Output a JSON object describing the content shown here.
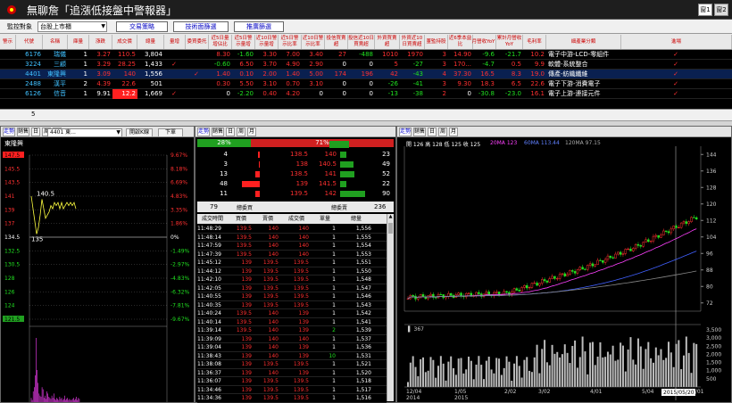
{
  "app": {
    "title": "無聊詹「追漲低接盤中警報器」",
    "win_buttons": [
      "窗1",
      "窗2"
    ]
  },
  "toolbar": {
    "monitor_label": "監控對象",
    "market_value": "台股上市櫃",
    "btn_strategy": "交易策略",
    "btn_tech": "技術面篩選",
    "btn_custom": "推廣篩選"
  },
  "grid": {
    "headers": [
      "警示",
      "代號",
      "名稱",
      "庫量",
      "漲跌",
      "成交價",
      "總量",
      "量增",
      "委買委托",
      "近5日量增佔比",
      "近5日警示量增",
      "近10日警示量增",
      "近5日警示比率",
      "近10日警示比率",
      "投信買賣超",
      "投信近10日買賣超",
      "外資買賣超",
      "外資近10日買賣超",
      "董監持股",
      "近6季本益比",
      "月營收YoY",
      "累計月營收YoY",
      "毛利率",
      "細產業分類",
      "進場"
    ],
    "rows": [
      {
        "code": "6176",
        "name": "瑞儀",
        "qty": "1",
        "price": "110.5",
        "price_chg": "3.27",
        "vol": "3,804",
        "vinc": "",
        "bid": "",
        "c1": "8.30",
        "c2": "-1.60",
        "c3": "3.30",
        "c4": "7.00",
        "c5": "3.40",
        "c6": "27",
        "c7": "-488",
        "c8": "1010",
        "c9": "1970",
        "c10": "3",
        "c11": "14.90",
        "c12": "-9.6",
        "c13": "-21.7",
        "c14": "10.2",
        "industry": "電子中游-LCD-零組件",
        "entry": true
      },
      {
        "code": "3224",
        "name": "三顧",
        "qty": "1",
        "price": "28.25",
        "price_chg": "3.29",
        "vol": "1,433",
        "vinc": "✓",
        "bid": "",
        "c1": "-0.60",
        "c2": "6.50",
        "c3": "3.70",
        "c4": "4.90",
        "c5": "2.90",
        "c6": "0",
        "c7": "0",
        "c8": "5",
        "c9": "-27",
        "c10": "3",
        "c11": "170...",
        "c12": "-4.7",
        "c13": "0.5",
        "c14": "9.9",
        "industry": "軟體-系統整合",
        "entry": true
      },
      {
        "code": "4401",
        "name": "東隆興",
        "qty": "1",
        "price": "140",
        "price_chg": "3.09",
        "vol": "1,556",
        "vinc": "",
        "bid": "✓",
        "c1": "1.40",
        "c2": "0.10",
        "c3": "2.00",
        "c4": "1.40",
        "c5": "5.00",
        "c6": "174",
        "c7": "196",
        "c8": "42",
        "c9": "-43",
        "c10": "4",
        "c11": "37.30",
        "c12": "16.5",
        "c13": "8.3",
        "c14": "19.0",
        "industry": "傳產-紡織纖維",
        "entry": true
      },
      {
        "code": "2488",
        "name": "漢平",
        "qty": "2",
        "price": "22.6",
        "price_chg": "4.39",
        "vol": "501",
        "vinc": "",
        "bid": "",
        "c1": "0.30",
        "c2": "5.50",
        "c3": "3.10",
        "c4": "0.70",
        "c5": "3.10",
        "c6": "0",
        "c7": "0",
        "c8": "-26",
        "c9": "-41",
        "c10": "3",
        "c11": "9.30",
        "c12": "18.3",
        "c13": "6.5",
        "c14": "22.6",
        "industry": "電子下游-消費電子",
        "entry": true
      },
      {
        "code": "6126",
        "name": "信音",
        "qty": "1",
        "price": "12.2",
        "price_chg": "9.91",
        "vol": "1,669",
        "vinc": "✓",
        "bid": "",
        "c1": "0",
        "c2": "-2.20",
        "c3": "0.40",
        "c4": "4.20",
        "c5": "0",
        "c6": "0",
        "c7": "0",
        "c8": "-13",
        "c9": "-38",
        "c10": "2",
        "c11": "0",
        "c12": "-30.8",
        "c13": "-23.0",
        "c14": "16.1",
        "industry": "電子上游-連接元件",
        "entry": true
      }
    ],
    "row_count": "5"
  },
  "left_panel": {
    "tabs": [
      "走勢",
      "銷售",
      "日",
      "周",
      "月"
    ],
    "stock_select": "4401 東...",
    "btn_kline": "開啟K線",
    "btn_order": "下單",
    "stock_name": "東隆興",
    "price_ticks": [
      "147.5",
      "145.5",
      "143.5",
      "141",
      "139",
      "137",
      "134.5",
      "132.5",
      "130.5",
      "128",
      "126",
      "124",
      "121.5"
    ],
    "pct_ticks": [
      "9.67%",
      "8.18%",
      "6.69%",
      "4.83%",
      "3.35%",
      "1.86%",
      "0%",
      "-1.49%",
      "-2.97%",
      "-4.83%",
      "-6.32%",
      "-7.81%",
      "-9.67%"
    ],
    "high_label": "140.5",
    "low_label": "135",
    "time_labels": [
      "09:00",
      "10:00",
      "11:00",
      "12:00",
      "13:00",
      "13:30"
    ]
  },
  "mid_panel": {
    "tabs": [
      "走勢",
      "銷售",
      "日",
      "周",
      "月"
    ],
    "buy_pct": "28%",
    "sell_pct": "71%",
    "depth": [
      {
        "bq": "4",
        "bp": "138.5",
        "sp": "140",
        "sq": "23"
      },
      {
        "bq": "3",
        "bp": "138",
        "sp": "140.5",
        "sq": "49"
      },
      {
        "bq": "13",
        "bp": "138.5",
        "sp": "141",
        "sq": "52"
      },
      {
        "bq": "48",
        "bp": "139",
        "sp": "141.5",
        "sq": "22"
      },
      {
        "bq": "11",
        "bp": "139.5",
        "sp": "142",
        "sq": "90"
      }
    ],
    "total_buy": "79",
    "total_buy_label": "總委買",
    "total_sell_label": "總委賣",
    "total_sell": "236",
    "tick_headers": [
      "成交時間",
      "買價",
      "賣價",
      "成交價",
      "單量",
      "總量"
    ],
    "ticks": [
      [
        "11:48:29",
        "139.5",
        "140",
        "140",
        "1",
        "1,556"
      ],
      [
        "11:48:14",
        "139.5",
        "140",
        "140",
        "1",
        "1,555"
      ],
      [
        "11:47:59",
        "139.5",
        "140",
        "140",
        "1",
        "1,554"
      ],
      [
        "11:47:39",
        "139.5",
        "140",
        "140",
        "1",
        "1,553"
      ],
      [
        "11:45:12",
        "139",
        "139.5",
        "139.5",
        "1",
        "1,551"
      ],
      [
        "11:44:12",
        "139",
        "139.5",
        "139.5",
        "1",
        "1,550"
      ],
      [
        "11:42:10",
        "139",
        "139.5",
        "139.5",
        "1",
        "1,548"
      ],
      [
        "11:42:05",
        "139",
        "139.5",
        "139.5",
        "1",
        "1,547"
      ],
      [
        "11:40:55",
        "139",
        "139.5",
        "139.5",
        "1",
        "1,546"
      ],
      [
        "11:40:35",
        "139",
        "139.5",
        "139.5",
        "1",
        "1,543"
      ],
      [
        "11:40:24",
        "139.5",
        "140",
        "139",
        "1",
        "1,542"
      ],
      [
        "11:40:14",
        "139.5",
        "140",
        "139",
        "1",
        "1,541"
      ],
      [
        "11:39:14",
        "139.5",
        "140",
        "139",
        "2",
        "1,539"
      ],
      [
        "11:39:09",
        "139",
        "140",
        "140",
        "1",
        "1,537"
      ],
      [
        "11:39:04",
        "139",
        "140",
        "139",
        "1",
        "1,536"
      ],
      [
        "11:38:43",
        "139",
        "140",
        "139",
        "10",
        "1,531"
      ],
      [
        "11:38:08",
        "139",
        "139.5",
        "139.5",
        "1",
        "1,521"
      ],
      [
        "11:36:37",
        "139",
        "140",
        "139",
        "1",
        "1,520"
      ],
      [
        "11:36:07",
        "139",
        "139.5",
        "139.5",
        "1",
        "1,518"
      ],
      [
        "11:34:46",
        "139",
        "139.5",
        "139.5",
        "1",
        "1,517"
      ],
      [
        "11:34:36",
        "139",
        "139.5",
        "139.5",
        "1",
        "1,516"
      ]
    ]
  },
  "right_panel": {
    "tabs": [
      "走勢",
      "銷售",
      "日",
      "周",
      "月"
    ],
    "ohlc_label": "開 126 高 128 低 125 收 125",
    "ma20_label": "20MA 123",
    "ma60_label": "60MA 113.44",
    "ma120_label": "120MA 97.15",
    "y_ticks": [
      "144",
      "136",
      "128",
      "120",
      "112",
      "104",
      "96",
      "88",
      "80",
      "72"
    ],
    "vol_label": "367",
    "vol_ticks": [
      "3,500",
      "3,000",
      "2,500",
      "2,000",
      "1,500",
      "1,000",
      "500"
    ],
    "x_labels": [
      "12/04",
      "1/05",
      "2/02",
      "3/02",
      "4/01",
      "5/04",
      "6/01"
    ],
    "year_labels": [
      "2014",
      "2015"
    ],
    "cursor_date": "2015/05/20"
  }
}
